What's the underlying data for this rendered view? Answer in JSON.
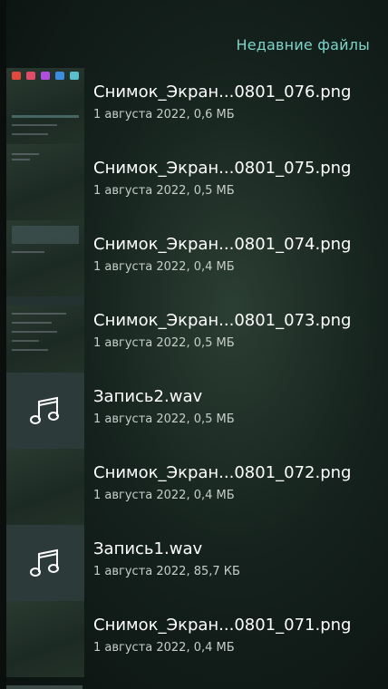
{
  "header": {
    "title": "Недавние файлы"
  },
  "files": [
    {
      "name": "Снимок_Экран...0801_076.png",
      "info": "1 августа 2022, 0,6 МБ",
      "type": "image",
      "icon": "image-thumbnail"
    },
    {
      "name": "Снимок_Экран...0801_075.png",
      "info": "1 августа 2022, 0,5 МБ",
      "type": "image",
      "icon": "image-thumbnail"
    },
    {
      "name": "Снимок_Экран...0801_074.png",
      "info": "1 августа 2022, 0,4 МБ",
      "type": "image",
      "icon": "image-thumbnail"
    },
    {
      "name": "Снимок_Экран...0801_073.png",
      "info": "1 августа 2022, 0,5 МБ",
      "type": "image",
      "icon": "image-thumbnail"
    },
    {
      "name": "Запись2.wav",
      "info": "1 августа 2022, 0,5 МБ",
      "type": "audio",
      "icon": "music-note-icon"
    },
    {
      "name": "Снимок_Экран...0801_072.png",
      "info": "1 августа 2022, 0,4 МБ",
      "type": "image",
      "icon": "image-thumbnail"
    },
    {
      "name": "Запись1.wav",
      "info": "1 августа 2022, 85,7 КБ",
      "type": "audio",
      "icon": "music-note-icon"
    },
    {
      "name": "Снимок_Экран...0801_071.png",
      "info": "1 августа 2022, 0,4 МБ",
      "type": "image",
      "icon": "image-thumbnail"
    }
  ],
  "colors": {
    "accent": "#7fd3c9"
  }
}
